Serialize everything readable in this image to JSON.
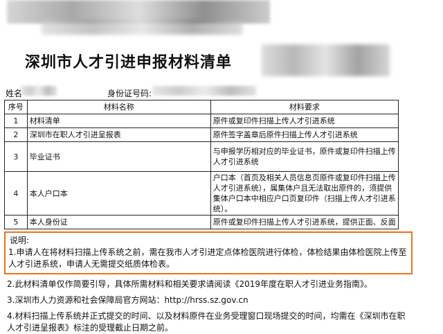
{
  "document": {
    "title": "深圳市人才引进申报材料清单",
    "name_label": "姓名",
    "id_label": "身份证号码:",
    "table": {
      "headers": [
        "序号",
        "材料名称",
        "材料要求"
      ],
      "rows": [
        {
          "no": "1",
          "name": "材料清单",
          "requirement": "原件或复印件扫描上传人才引进系统"
        },
        {
          "no": "2",
          "name": "深圳市在职人才引进呈报表",
          "requirement": "原件签字盖章后原件扫描上传人才引进系统"
        },
        {
          "no": "3",
          "name": "毕业证书",
          "requirement": "与申报学历相对应的毕业证书，原件或复印件扫描上传人才引进系统"
        },
        {
          "no": "4",
          "name": "本人户口本",
          "requirement": "户口本（首页及相关人员信息页原件或复印件扫描上传人才引进系统），属集体户且无法取出原件的，须提供集体户口本中相应户口页复印件（扫描上传人才引进系统）。"
        },
        {
          "no": "5",
          "name": "本人身份证",
          "requirement": "原件或复印件扫描上传人才引进系统，提供正面、反面"
        }
      ]
    },
    "notes": {
      "title": "说明:",
      "items": [
        "1.申请人在将材料扫描上传系统之前，需在我市人才引进定点体检医院进行体检，体检结果由体检医院上传至人才引进系统，申请人无需提交纸质体检表。",
        "2.此材料清单仅作简要引导，具体所需材料和相关要求请阅读《2019年度在职人才引进业务指南》。",
        "3.深圳市人力资源和社会保障局官方网站：http://hrss.sz.gov.cn",
        "4.材料扫描上传系统并正式提交的时间、以及材料原件在业务受理窗口现场提交的时间，均需在《深圳市在职人才引进呈报表》标注的受理截止日期之前。"
      ]
    },
    "highlight_color": "#e8731e"
  }
}
